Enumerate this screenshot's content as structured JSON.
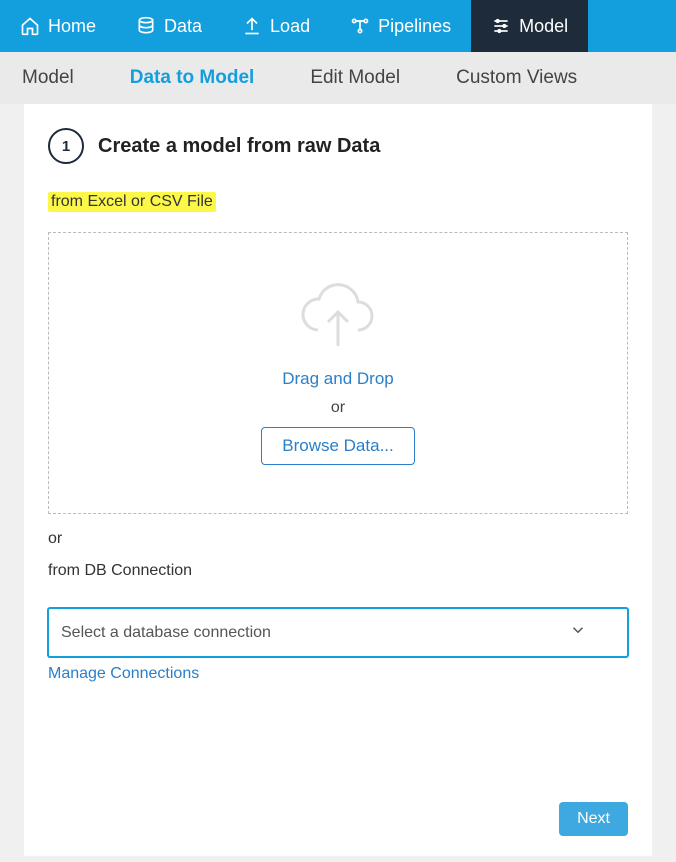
{
  "topnav": {
    "items": [
      {
        "label": "Home"
      },
      {
        "label": "Data"
      },
      {
        "label": "Load"
      },
      {
        "label": "Pipelines"
      },
      {
        "label": "Model"
      }
    ]
  },
  "subnav": {
    "items": [
      {
        "label": "Model"
      },
      {
        "label": "Data to Model"
      },
      {
        "label": "Edit Model"
      },
      {
        "label": "Custom Views"
      }
    ]
  },
  "step": {
    "number": "1",
    "title": "Create a model from raw Data"
  },
  "file_section": {
    "label": "from Excel or CSV File",
    "drop_text": "Drag and Drop",
    "or": "or",
    "browse": "Browse Data..."
  },
  "separator": "or",
  "db_section": {
    "label": "from DB Connection",
    "placeholder": "Select a database connection",
    "manage": "Manage Connections"
  },
  "next": "Next"
}
